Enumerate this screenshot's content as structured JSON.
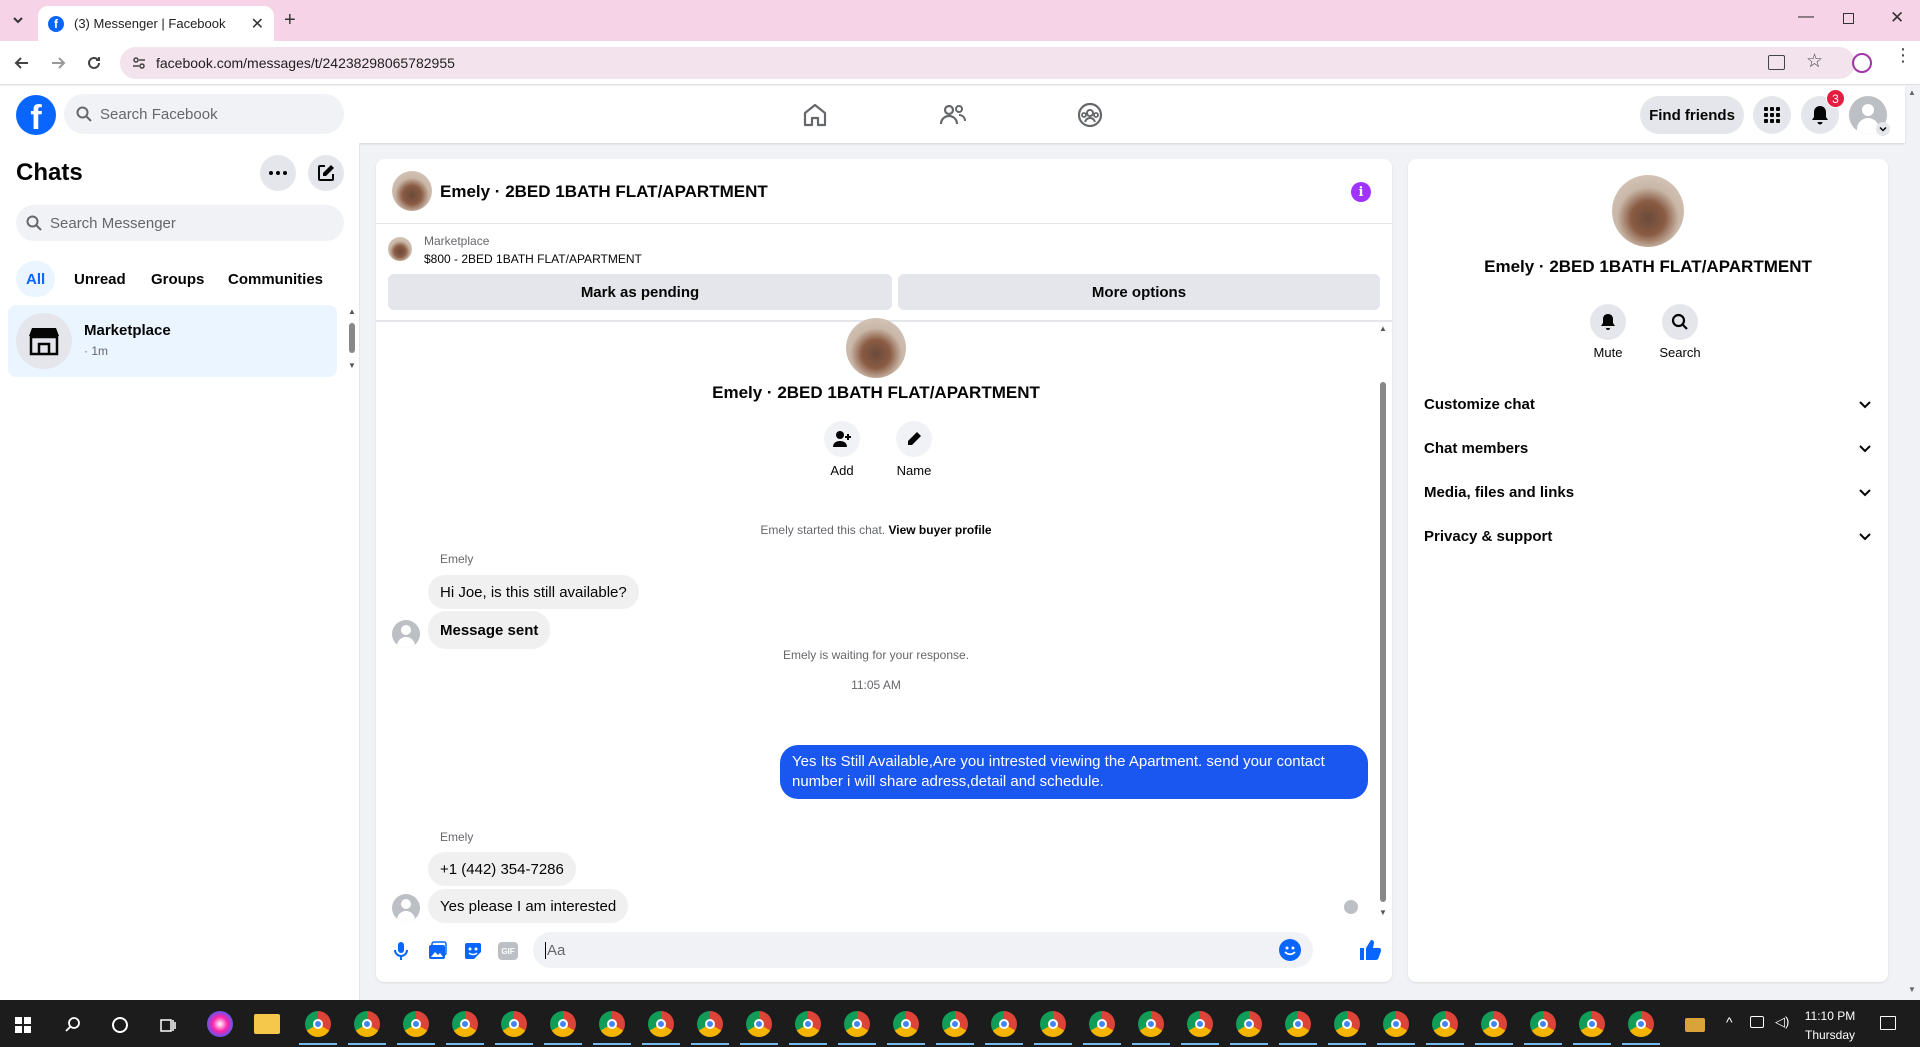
{
  "browser": {
    "tab_title": "(3) Messenger | Facebook",
    "url": "facebook.com/messages/t/24238298065782955"
  },
  "fb_header": {
    "search_placeholder": "Search Facebook",
    "find_friends": "Find friends",
    "notification_count": "3"
  },
  "chats": {
    "title": "Chats",
    "search_placeholder": "Search Messenger",
    "filters": [
      "All",
      "Unread",
      "Groups",
      "Communities"
    ],
    "items": [
      {
        "name": "Marketplace",
        "time": "· 1m"
      }
    ]
  },
  "conversation": {
    "header_title": "Emely · 2BED 1BATH FLAT/APARTMENT",
    "listing_label": "Marketplace",
    "listing_title": "$800 - 2BED 1BATH FLAT/APARTMENT",
    "mark_pending": "Mark as pending",
    "more_options": "More options",
    "profile_name": "Emely · 2BED 1BATH FLAT/APARTMENT",
    "add_label": "Add",
    "name_label": "Name",
    "started_text": "Emely started this chat.",
    "view_buyer_profile": "View buyer profile",
    "sender1": "Emely",
    "msg1": "Hi Joe, is this still available?",
    "msg2": "Message sent",
    "waiting_text": "Emely is waiting for your response.",
    "timestamp": "11:05 AM",
    "outgoing": "Yes Its Still Available,Are you intrested viewing the Apartment. send your contact number i will share adress,detail and schedule.",
    "sender2": "Emely",
    "msg3": "+1 (442) 354-7286",
    "msg4": "Yes please I am interested",
    "composer_placeholder": "Aa"
  },
  "details": {
    "name": "Emely · 2BED 1BATH FLAT/APARTMENT",
    "mute": "Mute",
    "search": "Search",
    "sections": [
      "Customize chat",
      "Chat members",
      "Media, files and links",
      "Privacy & support"
    ]
  },
  "taskbar": {
    "time": "11:10 PM",
    "day": "Thursday"
  },
  "colors": {
    "fb_blue": "#0866ff",
    "outgoing_bubble": "#1a56f0",
    "info_purple": "#a033ff",
    "badge_red": "#e41e3f"
  }
}
